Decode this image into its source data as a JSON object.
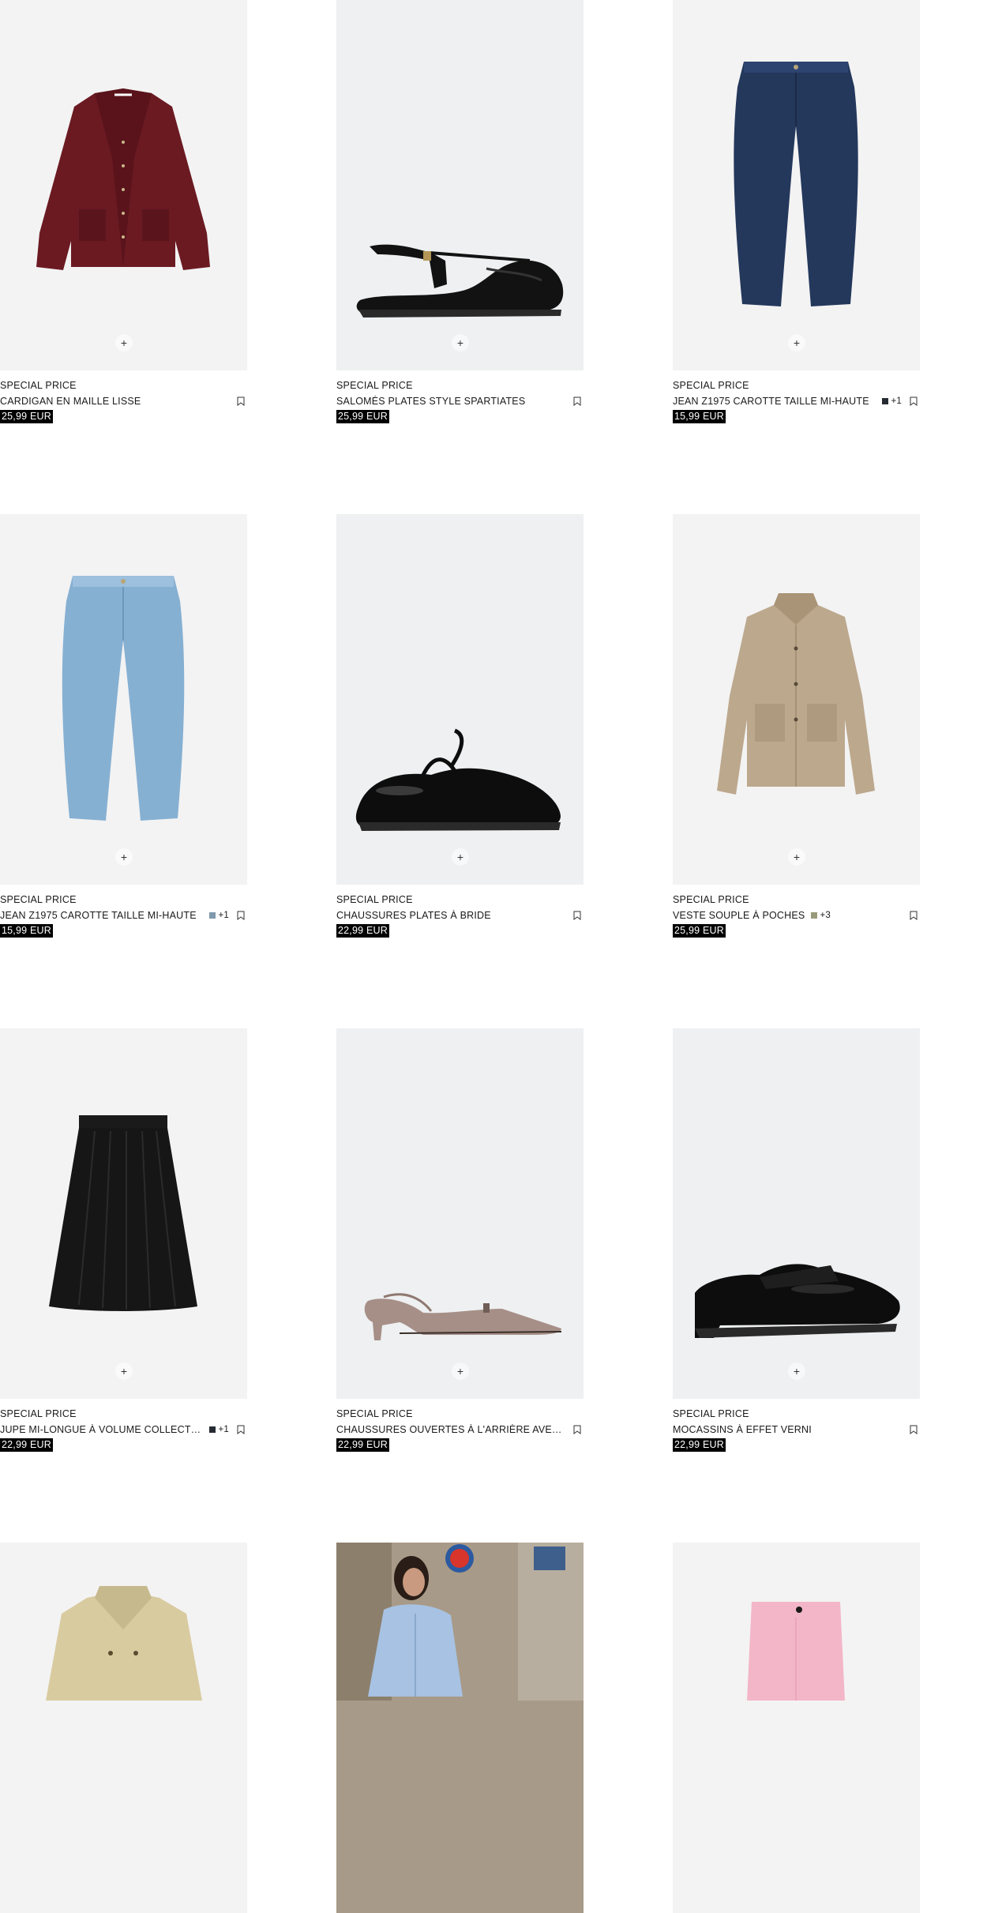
{
  "colors": {
    "swatch_dark": "#262b33",
    "swatch_blue": "#7f98ad",
    "swatch_olive": "#9a9a7a"
  },
  "products": [
    {
      "tag": "SPECIAL PRICE",
      "name": "CARDIGAN EN MAILLE LISSE",
      "price": "25,99 EUR",
      "extra_colors": "",
      "image": "burgundy-cardigan-icon"
    },
    {
      "tag": "SPECIAL PRICE",
      "name": "SALOMÉS PLATES STYLE SPARTIATES",
      "price": "25,99 EUR",
      "extra_colors": "",
      "image": "black-sandal-icon"
    },
    {
      "tag": "SPECIAL PRICE",
      "name": "JEAN Z1975 CAROTTE TAILLE MI-HAUTE",
      "price": "15,99 EUR",
      "extra_colors": "+1",
      "swatch_color": "#262b33",
      "image": "dark-jeans-icon"
    },
    {
      "tag": "SPECIAL PRICE",
      "name": "JEAN Z1975 CAROTTE TAILLE MI-HAUTE",
      "price": "15,99 EUR",
      "extra_colors": "+1",
      "swatch_color": "#7f98ad",
      "image": "light-jeans-icon"
    },
    {
      "tag": "SPECIAL PRICE",
      "name": "CHAUSSURES PLATES À BRIDE",
      "price": "22,99 EUR",
      "extra_colors": "",
      "image": "black-mary-jane-icon"
    },
    {
      "tag": "SPECIAL PRICE",
      "name": "VESTE SOUPLE À POCHES",
      "price": "25,99 EUR",
      "extra_colors": "+3",
      "swatch_color": "#9a9a7a",
      "image": "beige-jacket-icon"
    },
    {
      "tag": "SPECIAL PRICE",
      "name": "JUPE MI-LONGUE À VOLUME COLLECTION",
      "price": "22,99 EUR",
      "extra_colors": "+1",
      "swatch_color": "#262b33",
      "image": "black-skirt-icon"
    },
    {
      "tag": "SPECIAL PRICE",
      "name": "CHAUSSURES OUVERTES À L'ARRIÈRE AVEC TALON",
      "price": "22,99 EUR",
      "extra_colors": "",
      "image": "slingback-heel-icon"
    },
    {
      "tag": "SPECIAL PRICE",
      "name": "MOCASSINS À EFFET VERNI",
      "price": "22,99 EUR",
      "extra_colors": "",
      "image": "black-loafer-icon"
    },
    {
      "tag": "",
      "name": "",
      "price": "",
      "extra_colors": "",
      "image": "beige-trench-icon"
    },
    {
      "tag": "",
      "name": "",
      "price": "",
      "extra_colors": "",
      "image": "model-blue-shirt-icon"
    },
    {
      "tag": "",
      "name": "",
      "price": "",
      "extra_colors": "",
      "image": "pink-trousers-icon"
    }
  ],
  "actions": {
    "add_symbol": "+"
  }
}
